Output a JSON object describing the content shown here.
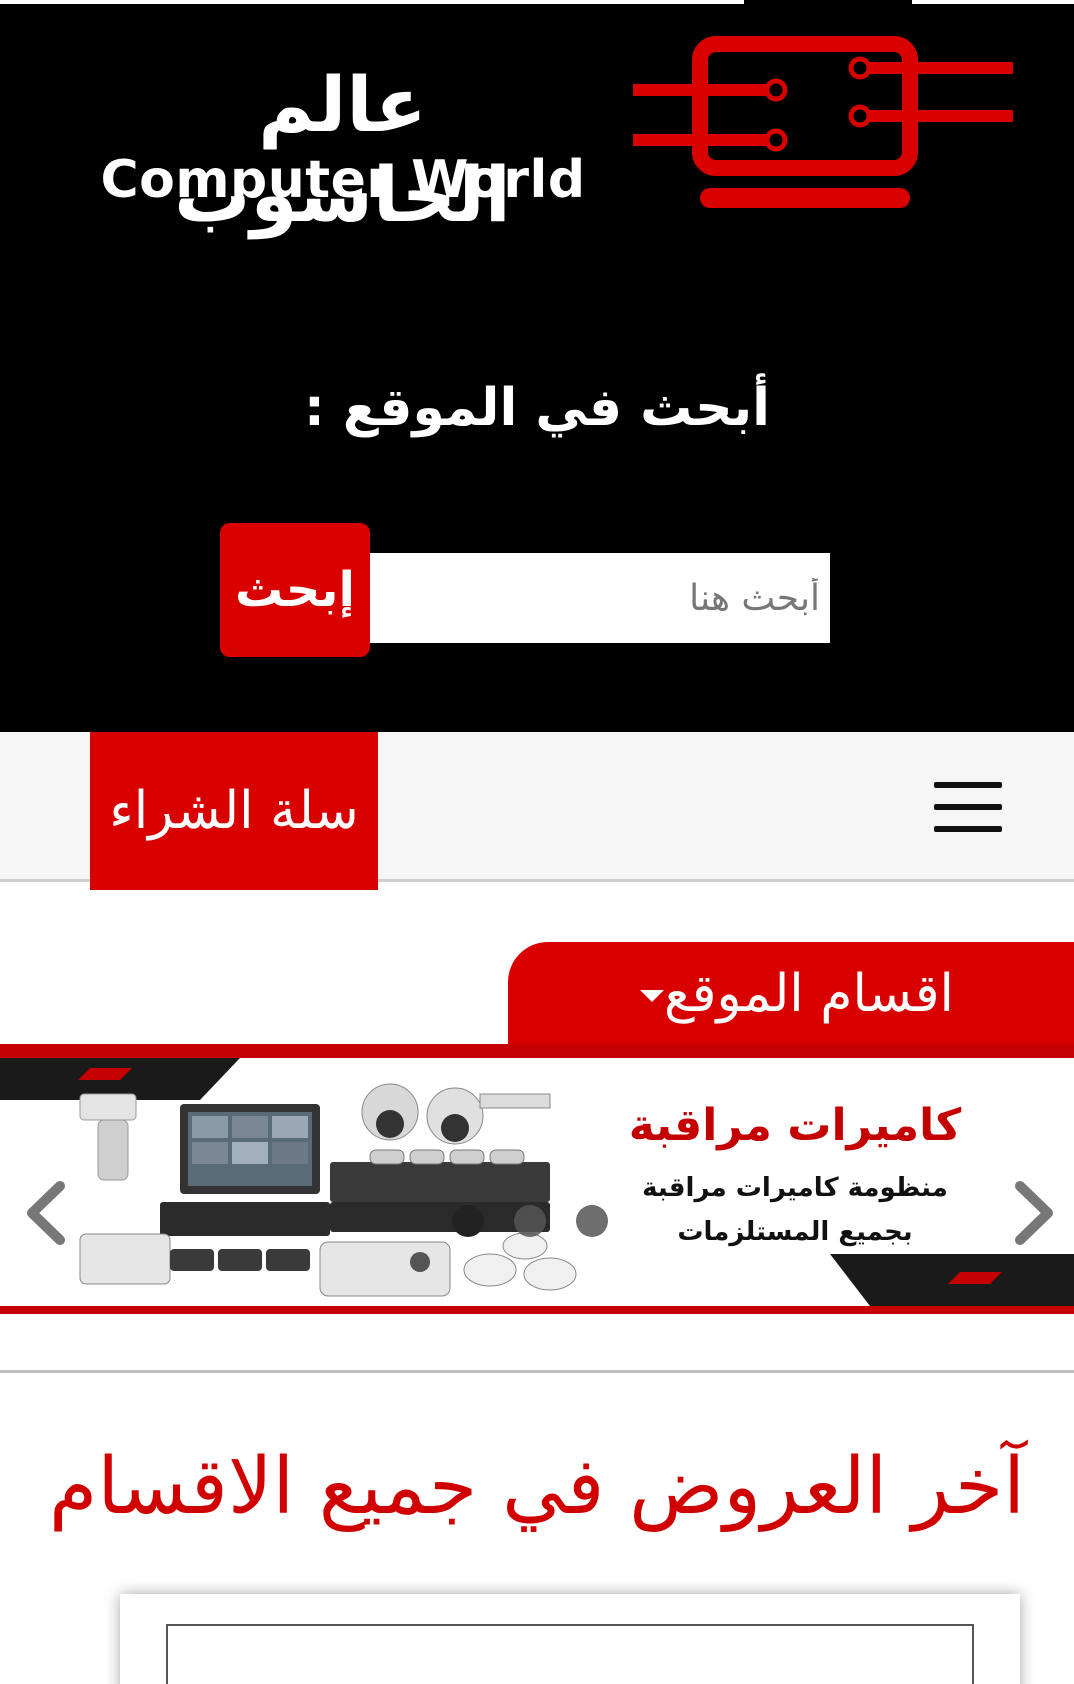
{
  "brand": {
    "name_ar": "عالم الحاسوب",
    "name_en": "Computer World"
  },
  "colors": {
    "accent": "#d90000",
    "header_bg": "#000000",
    "nav_bg": "#f6f6f6"
  },
  "search": {
    "heading": "أبحث في الموقع :",
    "placeholder": "أبحث هنا",
    "value": "",
    "button_label": "إبحث"
  },
  "nav": {
    "cart_label": "سلة الشراء",
    "menu_icon": "hamburger-icon"
  },
  "categories": {
    "label": "اقسام الموقع",
    "icon": "caret-down-icon"
  },
  "banner": {
    "title": "كاميرات مراقبة",
    "line1": "منظومة كاميرات مراقبة",
    "line2": "بجميع المستلزمات",
    "prev_icon": "chevron-left-icon",
    "next_icon": "chevron-right-icon",
    "slide_count": 3,
    "active_slide": 1
  },
  "offers": {
    "title": "آخر العروض في جميع الاقسام"
  }
}
